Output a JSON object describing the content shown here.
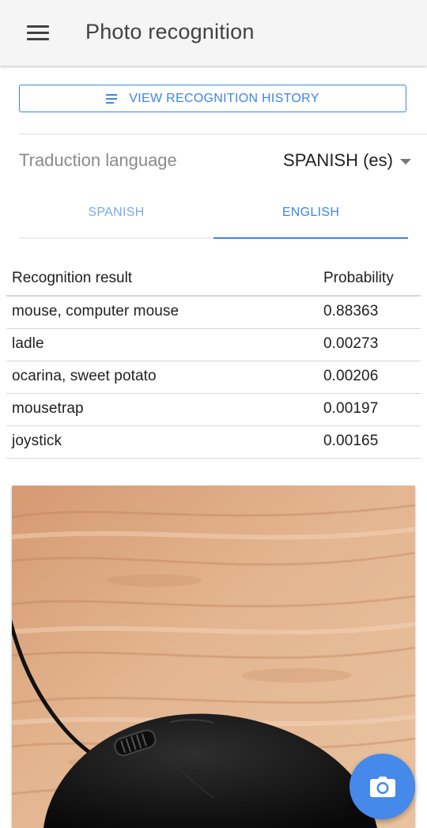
{
  "app": {
    "title": "Photo recognition"
  },
  "actions": {
    "history_label": "VIEW RECOGNITION HISTORY"
  },
  "language": {
    "label": "Traduction language",
    "selected": "SPANISH (es)"
  },
  "tabs": [
    {
      "label": "SPANISH"
    },
    {
      "label": "ENGLISH",
      "active": true
    }
  ],
  "results": {
    "headers": {
      "label": "Recognition result",
      "probability": "Probability"
    },
    "rows": [
      {
        "label": "mouse, computer mouse",
        "probability": "0.88363"
      },
      {
        "label": "ladle",
        "probability": "0.00273"
      },
      {
        "label": "ocarina, sweet potato",
        "probability": "0.00206"
      },
      {
        "label": "mousetrap",
        "probability": "0.00197"
      },
      {
        "label": "joystick",
        "probability": "0.00165"
      }
    ]
  },
  "icons": {
    "menu": "hamburger-menu-icon",
    "history": "list-icon",
    "dropdown": "caret-down-icon",
    "camera": "camera-icon"
  },
  "colors": {
    "accent": "#3d86e8",
    "appbar_background": "#f5f5f5",
    "fab": "#4589ea"
  }
}
